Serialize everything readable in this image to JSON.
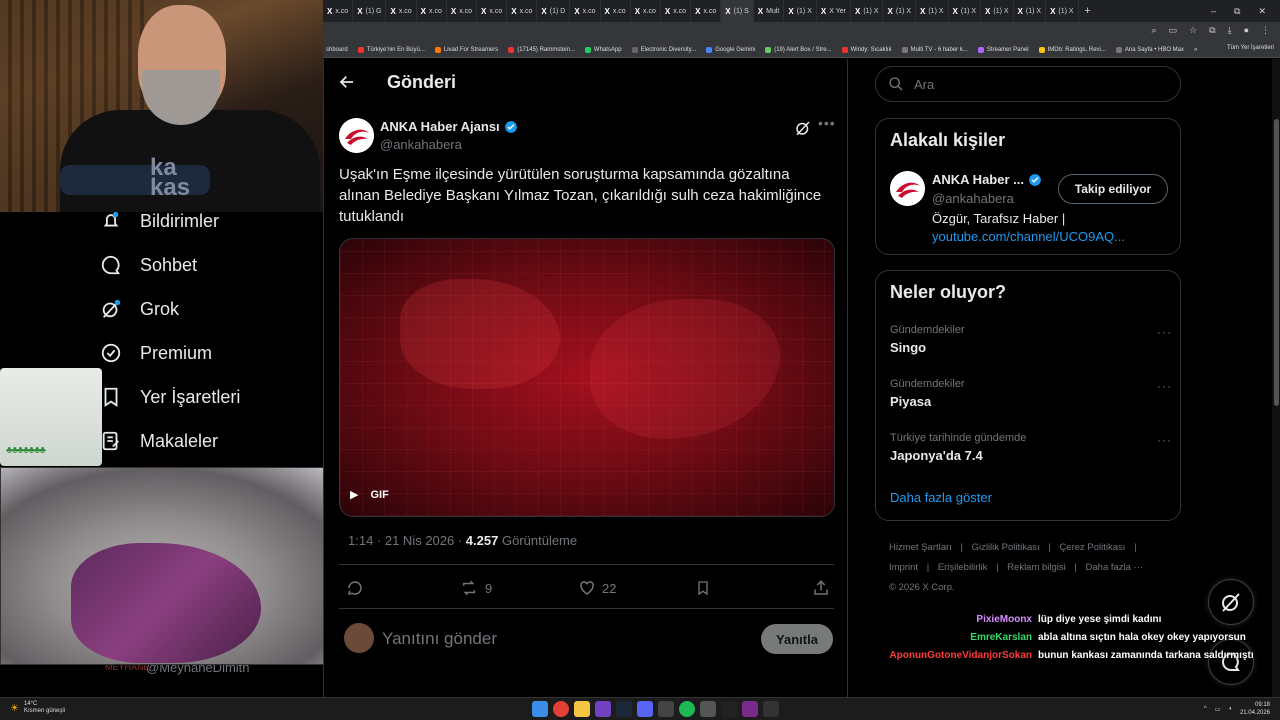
{
  "browser": {
    "tabs": [
      "X",
      "X",
      "X",
      "X",
      "X",
      "X",
      "X",
      "X",
      "X",
      "X",
      "X",
      "X",
      "X",
      "X",
      "X",
      "X",
      "X",
      "X",
      "X",
      "X",
      "X",
      "X",
      "X",
      "X"
    ],
    "tab_labels": [
      "x.co",
      "(1) G",
      "x.co",
      "x.co",
      "x.co",
      "x.co",
      "x.co",
      "(1) D",
      "x.co",
      "x.co",
      "x.co",
      "x.co",
      "x.co",
      "(1) S",
      "Mult",
      "(1) X",
      "X Yer",
      "(1) X",
      "(1) X",
      "(1) X",
      "(1) X",
      "(1) X",
      "(1) X",
      "(1) X"
    ],
    "new_tab": "+",
    "window_controls": [
      "–",
      "⧉",
      "✕"
    ],
    "bookmarks": [
      "shboard",
      "Türkiye'nin En Büyü...",
      "Livad For Streamers",
      "(17145) Rammstein...",
      "WhatsApp",
      "Electronic Diversity...",
      "Google Gemini",
      "(19) Alert Box / Stre...",
      "Windy: Sıcaklık",
      "Multi TV - 6 haber k...",
      "Streamer Panel",
      "IMDb: Ratings, Revi...",
      "Ana Sayfa • HBO Max"
    ],
    "bookmarks_more": "»",
    "all_bookmarks": "Tüm Yer İşaretleri"
  },
  "webcam": {
    "shirt_text_1": "ka",
    "shirt_text_2": "kas"
  },
  "nav": {
    "items": [
      {
        "label": "Bildirimler",
        "icon": "bell-icon"
      },
      {
        "label": "Sohbet",
        "icon": "chat-icon"
      },
      {
        "label": "Grok",
        "icon": "grok-icon"
      },
      {
        "label": "Premium",
        "icon": "verified-badge-icon"
      },
      {
        "label": "Yer İşaretleri",
        "icon": "bookmark-icon"
      },
      {
        "label": "Makaleler",
        "icon": "article-icon"
      }
    ],
    "under_label": "MEYHANE",
    "under_handle": "@MeyhaneDimith"
  },
  "post": {
    "header_title": "Gönderi",
    "author_name": "ANKA Haber Ajansı",
    "author_handle": "@ankahabera",
    "text": "Uşak'ın Eşme ilçesinde yürütülen soruşturma kapsamında gözaltına alınan Belediye Başkanı Yılmaz Tozan, çıkarıldığı sulh ceza hakimliğince tutuklandı",
    "media_badge": "GIF",
    "time": "1:14 · 21 Nis 2026 · ",
    "views": "4.257",
    "views_label": "Görüntüleme",
    "reposts": "9",
    "likes": "22",
    "reply_placeholder": "Yanıtını gönder",
    "reply_button": "Yanıtla"
  },
  "search": {
    "placeholder": "Ara"
  },
  "related": {
    "title": "Alakalı kişiler",
    "name": "ANKA Haber ...",
    "handle": "@ankahabera",
    "follow_label": "Takip ediliyor",
    "bio": "Özgür, Tarafsız Haber |",
    "link": "youtube.com/channel/UCO9AQ..."
  },
  "trends": {
    "title": "Neler oluyor?",
    "items": [
      {
        "category": "Gündemdekiler",
        "name": "Singo"
      },
      {
        "category": "Gündemdekiler",
        "name": "Piyasa"
      },
      {
        "category": "Türkiye tarihinde gündemde",
        "name": "Japonya'da 7.4"
      }
    ],
    "more_dots": "···",
    "show_more": "Daha fazla göster"
  },
  "footer": {
    "links": [
      "Hizmet Şartları",
      "|",
      "Gizlilik Politikası",
      "|",
      "Çerez Politikası",
      "|",
      "Imprint",
      "|",
      "Erişilebilirlik",
      "|",
      "Reklam bilgisi",
      "|",
      "Daha fazla ···"
    ],
    "copyright": "© 2026 X Corp."
  },
  "chat": [
    {
      "user": "PixieMoonx",
      "color": "#d58cff",
      "msg": "lüp diye yese şimdi kadını"
    },
    {
      "user": "EmreKarslan",
      "color": "#39d66b",
      "msg": "abla altına sıçtın hala okey okey yapıyorsun"
    },
    {
      "user": "AponunGotoneVidanjorSokan",
      "color": "#ff3a3a",
      "msg": "bunun kankası zamanında tarkana saldırmıştı"
    }
  ],
  "taskbar": {
    "weather_temp": "14°C",
    "weather_desc": "Kısmen güneşli",
    "time": "09:18",
    "date": "21.04.2026"
  },
  "colors": {
    "accent": "#1d9bf0",
    "background": "#000000",
    "border": "#2f3336",
    "muted": "#71767b"
  }
}
